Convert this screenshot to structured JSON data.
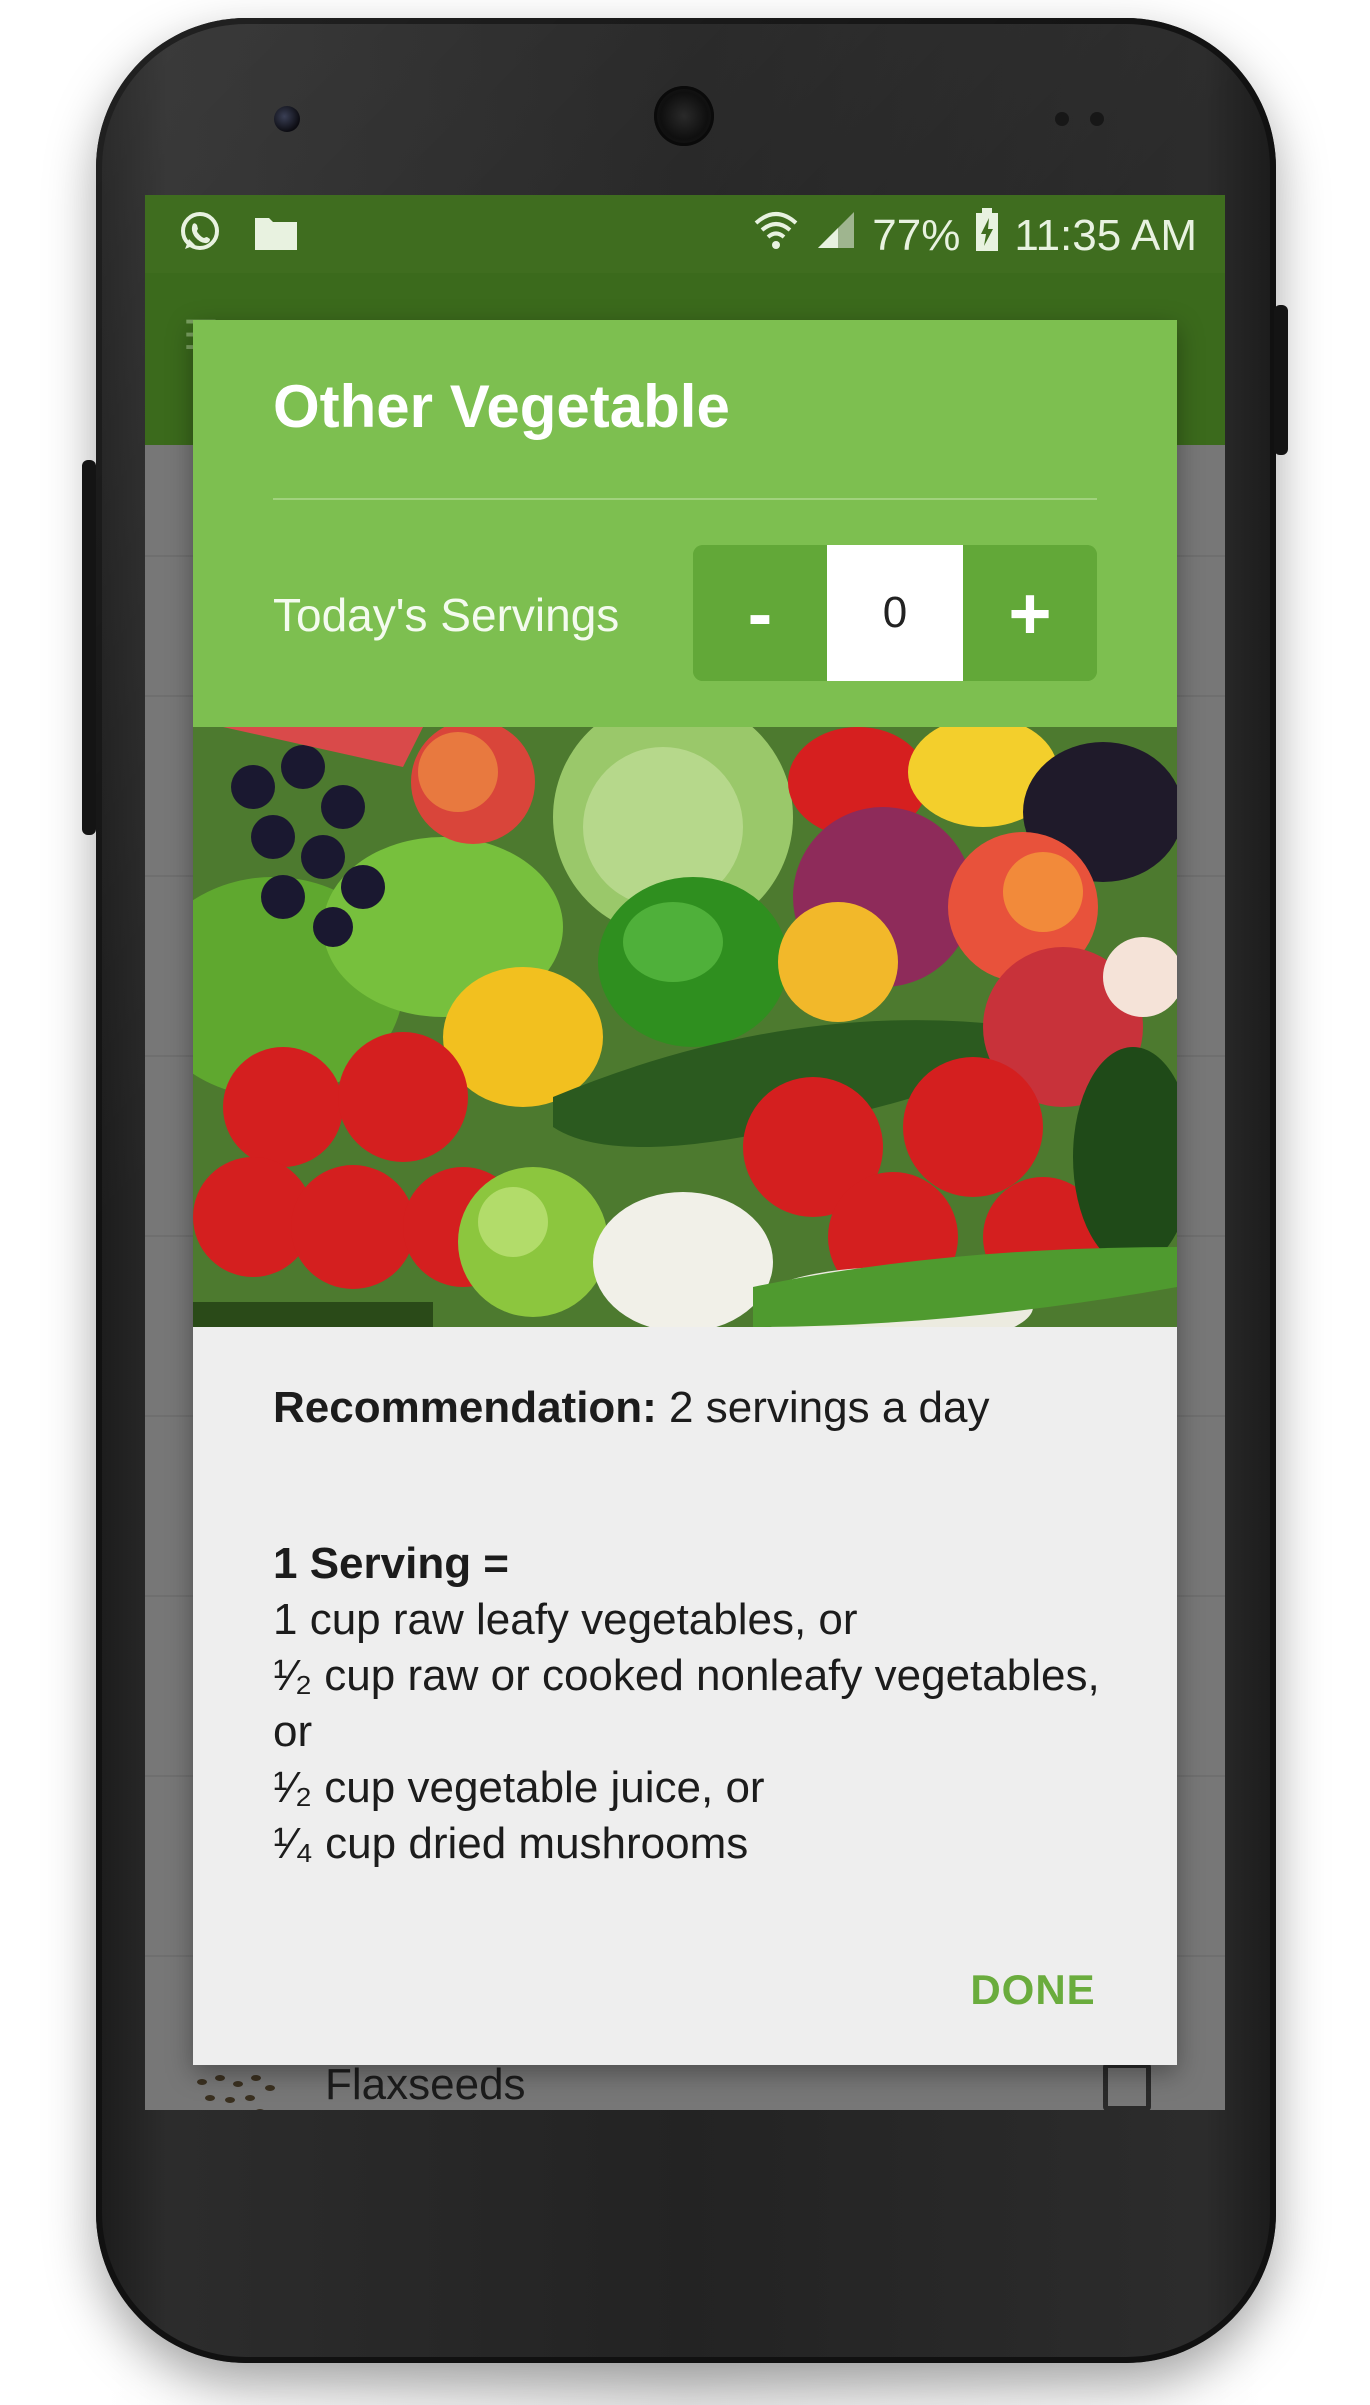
{
  "status_bar": {
    "battery": "77%",
    "time": "11:35 AM",
    "left_icons": [
      "whatsapp-icon",
      "folder-icon"
    ],
    "right_icons": [
      "wifi-icon",
      "cell-signal-icon",
      "battery-charging-icon"
    ]
  },
  "dialog": {
    "title": "Other Vegetable",
    "servings_label": "Today's Servings",
    "decrement_label": "-",
    "increment_label": "+",
    "servings_value": "0",
    "recommendation_label": "Recommendation:",
    "recommendation_value": " 2 servings a day",
    "serving_title": "1 Serving =",
    "serving_lines": [
      "1 cup raw leafy vegetables, or",
      "¹⁄₂ cup raw or cooked nonleafy vegetables, or",
      "¹⁄₂ cup vegetable juice, or",
      "¹⁄₄ cup dried mushrooms"
    ],
    "done_label": "DONE"
  },
  "list_behind": {
    "visible_item": "Flaxseeds"
  },
  "colors": {
    "header_green": "#7dbf50",
    "stepper_green": "#62a838",
    "app_bar_green": "#3b6a1c",
    "done_green": "#6aac3d",
    "dialog_body": "#eeeeee"
  }
}
